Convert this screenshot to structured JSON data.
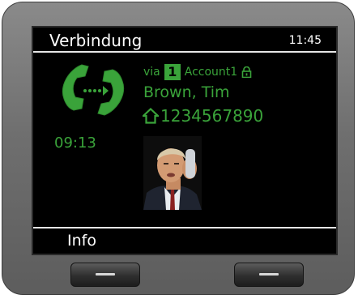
{
  "header": {
    "title": "Verbindung",
    "time": "11:45"
  },
  "call": {
    "via_label": "via",
    "account_number": "1",
    "account_name": "Account1",
    "caller_name": "Brown, Tim",
    "phone_number": "1234567890",
    "duration": "09:13"
  },
  "softkeys": {
    "left_label": "Info"
  },
  "icons": {
    "handset": "handset-arrow-icon",
    "lock": "lock-icon",
    "home": "home-icon",
    "avatar": "caller-photo"
  },
  "colors": {
    "accent_green": "#3aa33a",
    "screen_bg": "#000000",
    "bezel": "#6f6f6f"
  }
}
